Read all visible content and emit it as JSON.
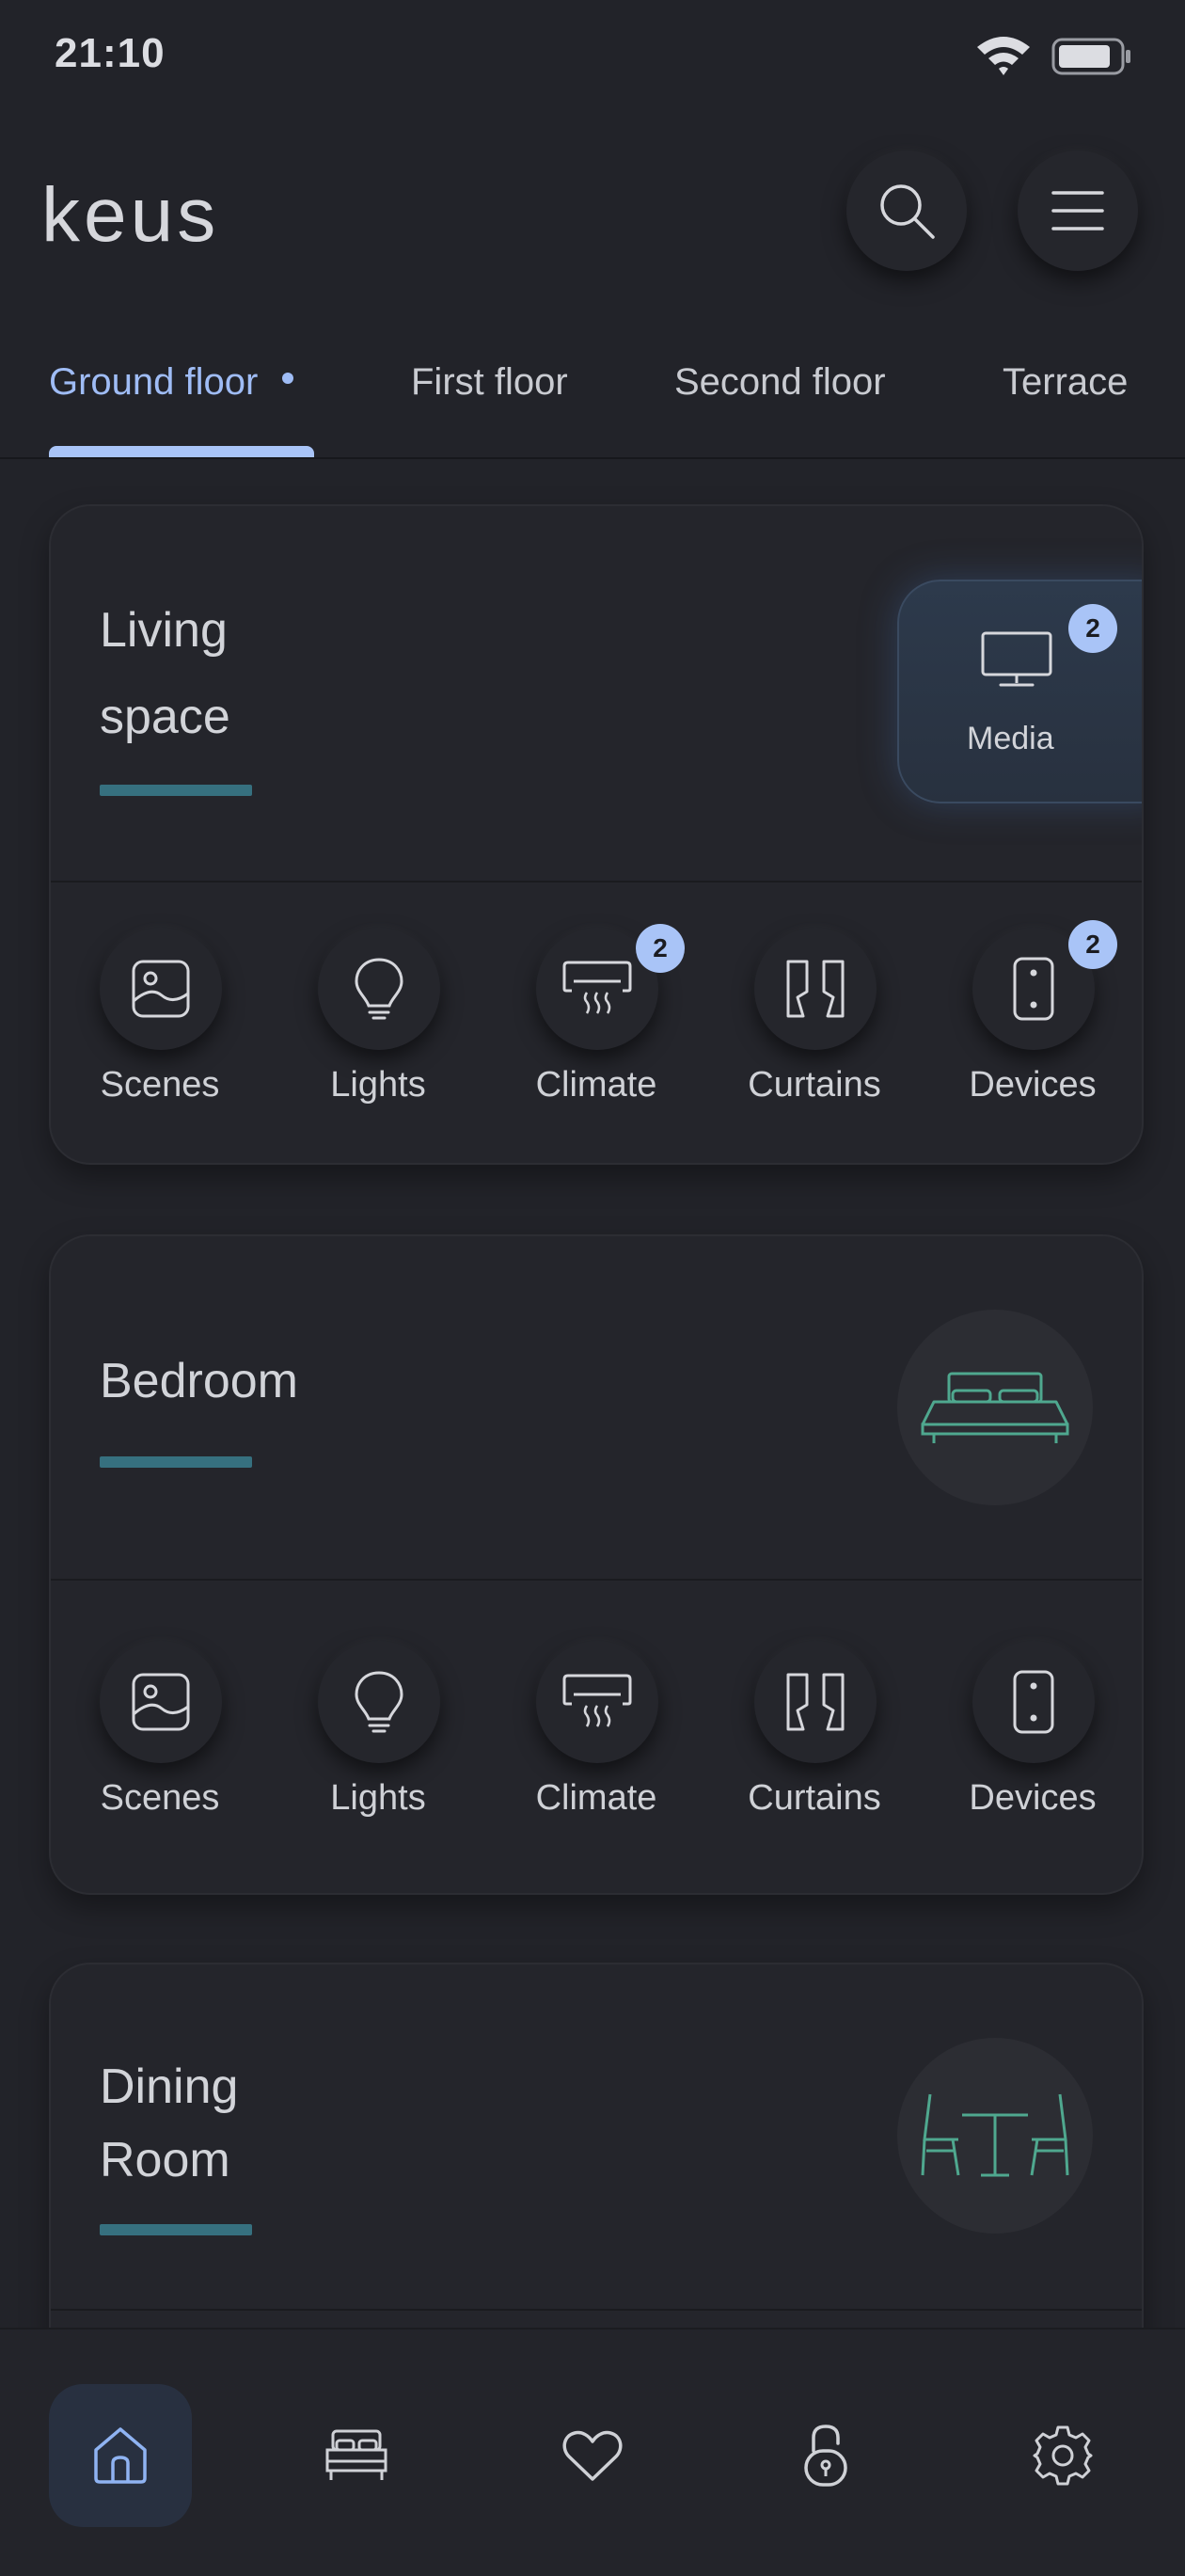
{
  "status": {
    "time": "21:10"
  },
  "app": {
    "logo": "keus"
  },
  "header": {
    "search_icon": "search-icon",
    "menu_icon": "hamburger-menu-icon"
  },
  "floors": [
    {
      "label": "Ground floor",
      "active": true
    },
    {
      "label": "First floor"
    },
    {
      "label": "Second floor"
    },
    {
      "label": "Terrace"
    }
  ],
  "rooms": [
    {
      "name_lines": [
        "Living",
        "space"
      ],
      "feature_tile": {
        "label": "Media",
        "badge": "2",
        "icon": "tv-icon"
      },
      "categories": [
        {
          "label": "Scenes",
          "icon": "image-icon"
        },
        {
          "label": "Lights",
          "icon": "bulb-icon"
        },
        {
          "label": "Climate",
          "icon": "ac-icon",
          "badge": "2"
        },
        {
          "label": "Curtains",
          "icon": "curtain-icon"
        },
        {
          "label": "Devices",
          "icon": "switch-panel-icon",
          "badge": "2"
        }
      ]
    },
    {
      "name_lines": [
        "Bedroom"
      ],
      "room_icon": "bed-icon",
      "categories": [
        {
          "label": "Scenes",
          "icon": "image-icon"
        },
        {
          "label": "Lights",
          "icon": "bulb-icon"
        },
        {
          "label": "Climate",
          "icon": "ac-icon"
        },
        {
          "label": "Curtains",
          "icon": "curtain-icon"
        },
        {
          "label": "Devices",
          "icon": "switch-panel-icon"
        }
      ]
    },
    {
      "name_lines": [
        "Dining",
        "Room"
      ],
      "room_icon": "dining-table-icon"
    }
  ],
  "bottom_nav": [
    {
      "icon": "home-icon",
      "active": true
    },
    {
      "icon": "bed-icon"
    },
    {
      "icon": "heart-icon"
    },
    {
      "icon": "lock-icon"
    },
    {
      "icon": "gear-icon"
    }
  ],
  "colors": {
    "background": "#222329",
    "accent": "#a9c4f7",
    "room_bar": "#36707f",
    "room_icon_green": "#4fa88f"
  }
}
